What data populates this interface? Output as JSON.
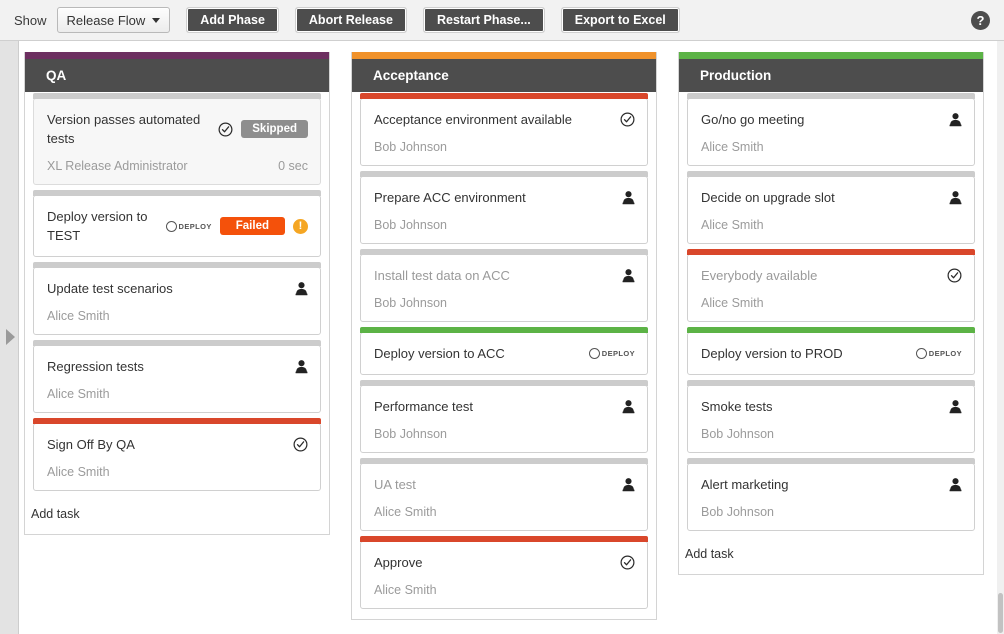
{
  "toolbar": {
    "show_label": "Show",
    "dropdown_value": "Release Flow",
    "buttons": [
      {
        "label": "Add Phase"
      },
      {
        "label": "Abort Release"
      },
      {
        "label": "Restart Phase..."
      },
      {
        "label": "Export to Excel"
      }
    ],
    "help_icon_glyph": "?"
  },
  "colors": {
    "qa_strip": "#6d2f60",
    "acceptance_strip": "#f0922b",
    "production_strip": "#5cb346",
    "card_bar_red": "#d9472b",
    "card_bar_green": "#5cb346",
    "card_bar_grey": "#cccccc",
    "header_bg": "#4d4d4d",
    "badge_failed": "#f4510b",
    "badge_skipped": "#8e8e8e",
    "warning": "#f5a623"
  },
  "add_task_label": "Add task",
  "phases": [
    {
      "title": "QA",
      "strip_color": "#6d2f60",
      "show_add_task": true,
      "tasks": [
        {
          "title": "Version passes automated tests",
          "title_muted": false,
          "owner": "XL Release Administrator",
          "duration": "0 sec",
          "bar_color": "#cccccc",
          "inactive": true,
          "icons": [
            "check-circle-icon"
          ],
          "badge": {
            "label": "Skipped",
            "style": "skipped"
          }
        },
        {
          "title": "Deploy version to TEST",
          "title_muted": false,
          "owner": "",
          "duration": "",
          "bar_color": "#cccccc",
          "inactive": false,
          "icons": [
            "xl-deploy-icon",
            "warning-icon"
          ],
          "badge": {
            "label": "Failed",
            "style": "failed"
          }
        },
        {
          "title": "Update test scenarios",
          "title_muted": false,
          "owner": "Alice Smith",
          "duration": "",
          "bar_color": "#cccccc",
          "inactive": false,
          "icons": [
            "person-icon"
          ],
          "badge": null
        },
        {
          "title": "Regression tests",
          "title_muted": false,
          "owner": "Alice Smith",
          "duration": "",
          "bar_color": "#cccccc",
          "inactive": false,
          "icons": [
            "person-icon"
          ],
          "badge": null
        },
        {
          "title": "Sign Off By QA",
          "title_muted": false,
          "owner": "Alice Smith",
          "duration": "",
          "bar_color": "#d9472b",
          "inactive": false,
          "icons": [
            "check-circle-icon"
          ],
          "badge": null
        }
      ]
    },
    {
      "title": "Acceptance",
      "strip_color": "#f0922b",
      "show_add_task": false,
      "tasks": [
        {
          "title": "Acceptance environment available",
          "title_muted": false,
          "owner": "Bob Johnson",
          "duration": "",
          "bar_color": "#d9472b",
          "inactive": false,
          "icons": [
            "check-circle-icon"
          ],
          "badge": null
        },
        {
          "title": "Prepare ACC environment",
          "title_muted": false,
          "owner": "Bob Johnson",
          "duration": "",
          "bar_color": "#cccccc",
          "inactive": false,
          "icons": [
            "person-icon"
          ],
          "badge": null
        },
        {
          "title": "Install test data on ACC",
          "title_muted": true,
          "owner": "Bob Johnson",
          "duration": "",
          "bar_color": "#cccccc",
          "inactive": false,
          "icons": [
            "person-icon"
          ],
          "badge": null
        },
        {
          "title": "Deploy version to ACC",
          "title_muted": false,
          "owner": "",
          "duration": "",
          "bar_color": "#5cb346",
          "inactive": false,
          "icons": [
            "xl-deploy-icon"
          ],
          "badge": null
        },
        {
          "title": "Performance test",
          "title_muted": false,
          "owner": "Bob Johnson",
          "duration": "",
          "bar_color": "#cccccc",
          "inactive": false,
          "icons": [
            "person-icon"
          ],
          "badge": null
        },
        {
          "title": "UA test",
          "title_muted": true,
          "owner": "Alice Smith",
          "duration": "",
          "bar_color": "#cccccc",
          "inactive": false,
          "icons": [
            "person-icon"
          ],
          "badge": null
        },
        {
          "title": "Approve",
          "title_muted": false,
          "owner": "Alice Smith",
          "duration": "",
          "bar_color": "#d9472b",
          "inactive": false,
          "icons": [
            "check-circle-icon"
          ],
          "badge": null
        }
      ]
    },
    {
      "title": "Production",
      "strip_color": "#5cb346",
      "show_add_task": true,
      "tasks": [
        {
          "title": "Go/no go meeting",
          "title_muted": false,
          "owner": "Alice Smith",
          "duration": "",
          "bar_color": "#cccccc",
          "inactive": false,
          "icons": [
            "person-icon"
          ],
          "badge": null
        },
        {
          "title": "Decide on upgrade slot",
          "title_muted": false,
          "owner": "Alice Smith",
          "duration": "",
          "bar_color": "#cccccc",
          "inactive": false,
          "icons": [
            "person-icon"
          ],
          "badge": null
        },
        {
          "title": "Everybody available",
          "title_muted": true,
          "owner": "Alice Smith",
          "duration": "",
          "bar_color": "#d9472b",
          "inactive": false,
          "icons": [
            "check-circle-icon"
          ],
          "badge": null
        },
        {
          "title": "Deploy version to PROD",
          "title_muted": false,
          "owner": "",
          "duration": "",
          "bar_color": "#5cb346",
          "inactive": false,
          "icons": [
            "xl-deploy-icon"
          ],
          "badge": null
        },
        {
          "title": "Smoke tests",
          "title_muted": false,
          "owner": "Bob Johnson",
          "duration": "",
          "bar_color": "#cccccc",
          "inactive": false,
          "icons": [
            "person-icon"
          ],
          "badge": null
        },
        {
          "title": "Alert marketing",
          "title_muted": false,
          "owner": "Bob Johnson",
          "duration": "",
          "bar_color": "#cccccc",
          "inactive": false,
          "icons": [
            "person-icon"
          ],
          "badge": null
        }
      ]
    }
  ]
}
